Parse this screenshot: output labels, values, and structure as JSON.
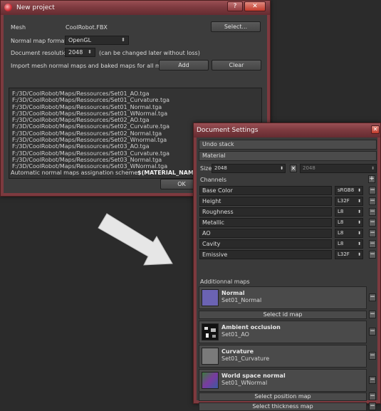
{
  "new_project": {
    "title": "New project",
    "help_btn": "?",
    "close_btn": "✕",
    "mesh_label": "Mesh",
    "mesh_value": "CoolRobot.FBX",
    "select_button": "Select...",
    "normal_format_label": "Normal map format",
    "normal_format_value": "OpenGL",
    "resolution_label": "Document resolution",
    "resolution_value": "2048",
    "resolution_note": "(can be changed later without loss)",
    "import_label": "Import mesh normal maps and baked maps for all materials.",
    "add_button": "Add",
    "clear_button": "Clear",
    "files": [
      "F:/3D/CoolRobot/Maps/Ressources/Set01_AO.tga",
      "F:/3D/CoolRobot/Maps/Ressources/Set01_Curvature.tga",
      "F:/3D/CoolRobot/Maps/Ressources/Set01_Normal.tga",
      "F:/3D/CoolRobot/Maps/Ressources/Set01_WNormal.tga",
      "F:/3D/CoolRobot/Maps/Ressources/Set02_AO.tga",
      "F:/3D/CoolRobot/Maps/Ressources/Set02_Curvature.tga",
      "F:/3D/CoolRobot/Maps/Ressources/Set02_Normal.tga",
      "F:/3D/CoolRobot/Maps/Ressources/Set02_Wnormal.tga",
      "F:/3D/CoolRobot/Maps/Ressources/Set03_AO.tga",
      "F:/3D/CoolRobot/Maps/Ressources/Set03_Curvature.tga",
      "F:/3D/CoolRobot/Maps/Ressources/Set03_Normal.tga",
      "F:/3D/CoolRobot/Maps/Ressources/Set03_WNormal.tga"
    ],
    "scheme_label": "Automatic normal maps assignation scheme:",
    "scheme_value": "$(MATERIAL_NAME)_normal",
    "ok_button": "OK"
  },
  "doc_settings": {
    "title": "Document Settings",
    "close_btn": "✕",
    "undo_stack": "Undo stack",
    "material": "Material",
    "size_label": "Size",
    "size_w": "2048",
    "size_h": "2048",
    "channels_label": "Channels",
    "channels": [
      {
        "name": "Base Color",
        "format": "sRGB8"
      },
      {
        "name": "Height",
        "format": "L32F"
      },
      {
        "name": "Roughness",
        "format": "L8"
      },
      {
        "name": "Metallic",
        "format": "L8"
      },
      {
        "name": "AO",
        "format": "L8"
      },
      {
        "name": "Cavity",
        "format": "L8"
      },
      {
        "name": "Emissive",
        "format": "L32F"
      }
    ],
    "additional_maps_label": "Additionnal maps",
    "normal_map": {
      "name": "Normal",
      "file": "Set01_Normal"
    },
    "select_id_map": "Select id map",
    "ao_map": {
      "name": "Ambient occlusion",
      "file": "Set01_AO"
    },
    "curvature_map": {
      "name": "Curvature",
      "file": "Set01_Curvature"
    },
    "ws_normal_map": {
      "name": "World space normal",
      "file": "Set01_WNormal"
    },
    "select_position_map": "Select position map",
    "select_thickness_map": "Select thickness map"
  },
  "colors": {
    "title_bar": "#7e3b40",
    "panel": "#3a3a3a",
    "normal_thumb": "#6b63b3",
    "curvature_thumb": "#7a7a7a"
  }
}
